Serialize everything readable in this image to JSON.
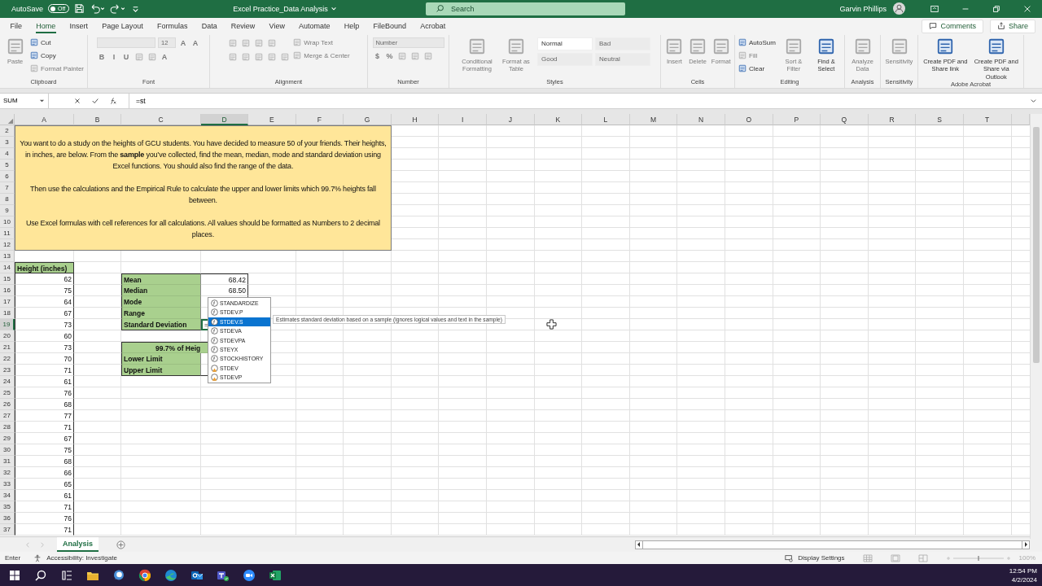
{
  "titlebar": {
    "autosave_label": "AutoSave",
    "autosave_state": "Off",
    "autosave_on": false,
    "title": "Excel Practice_Data Analysis",
    "search_placeholder": "Search",
    "user": "Garvin Phillips"
  },
  "menu_tabs": [
    {
      "label": "File",
      "selected": false
    },
    {
      "label": "Home",
      "selected": true
    },
    {
      "label": "Insert",
      "selected": false
    },
    {
      "label": "Page Layout",
      "selected": false
    },
    {
      "label": "Formulas",
      "selected": false
    },
    {
      "label": "Data",
      "selected": false
    },
    {
      "label": "Review",
      "selected": false
    },
    {
      "label": "View",
      "selected": false
    },
    {
      "label": "Automate",
      "selected": false
    },
    {
      "label": "Help",
      "selected": false
    },
    {
      "label": "FileBound",
      "selected": false
    },
    {
      "label": "Acrobat",
      "selected": false
    }
  ],
  "comments_button": "Comments",
  "share_button": "Share",
  "ribbon": [
    {
      "label": "Clipboard",
      "items": [
        {
          "kind": "large",
          "label": "Paste",
          "disabled": true
        },
        {
          "kind": "stack",
          "items": [
            {
              "kind": "small",
              "label": "Cut",
              "disabled": false
            },
            {
              "kind": "small",
              "label": "Copy",
              "disabled": false
            },
            {
              "kind": "small",
              "label": "Format Painter",
              "disabled": true
            }
          ]
        }
      ]
    },
    {
      "label": "Font",
      "items": [
        {
          "kind": "stack",
          "items": [
            {
              "kind": "row",
              "items": [
                {
                  "kind": "field",
                  "disabled": true
                },
                {
                  "kind": "field",
                  "value": "12",
                  "disabled": true
                },
                {
                  "kind": "glyph",
                  "label": "A",
                  "disabled": true
                },
                {
                  "kind": "glyph",
                  "label": "A",
                  "disabled": true
                }
              ]
            },
            {
              "kind": "row",
              "items": [
                {
                  "kind": "glyph",
                  "label": "B",
                  "disabled": true
                },
                {
                  "kind": "glyph",
                  "label": "I",
                  "disabled": true
                },
                {
                  "kind": "glyph",
                  "label": "U",
                  "disabled": true
                },
                {
                  "kind": "icon",
                  "disabled": true
                },
                {
                  "kind": "icon",
                  "disabled": true
                },
                {
                  "kind": "glyph",
                  "label": "A",
                  "disabled": true
                }
              ]
            }
          ]
        }
      ]
    },
    {
      "label": "Alignment",
      "items": [
        {
          "kind": "stack",
          "items": [
            {
              "kind": "row",
              "items": [
                {
                  "kind": "icon",
                  "disabled": true
                },
                {
                  "kind": "icon",
                  "disabled": true
                },
                {
                  "kind": "icon",
                  "disabled": true
                },
                {
                  "kind": "icon",
                  "disabled": true
                }
              ]
            },
            {
              "kind": "row",
              "items": [
                {
                  "kind": "icon",
                  "disabled": true
                },
                {
                  "kind": "icon",
                  "disabled": true
                },
                {
                  "kind": "icon",
                  "disabled": true
                },
                {
                  "kind": "icon",
                  "disabled": true
                },
                {
                  "kind": "icon",
                  "disabled": true
                }
              ]
            }
          ]
        },
        {
          "kind": "stack",
          "items": [
            {
              "kind": "small",
              "label": "Wrap Text",
              "disabled": true
            },
            {
              "kind": "small",
              "label": "Merge & Center",
              "disabled": true
            }
          ]
        }
      ]
    },
    {
      "label": "Number",
      "items": [
        {
          "kind": "stack",
          "items": [
            {
              "kind": "field",
              "value": "Number",
              "disabled": true
            },
            {
              "kind": "row",
              "items": [
                {
                  "kind": "glyph",
                  "label": "$",
                  "disabled": true
                },
                {
                  "kind": "glyph",
                  "label": "%",
                  "disabled": true
                },
                {
                  "kind": "icon",
                  "disabled": true
                },
                {
                  "kind": "icon",
                  "disabled": true
                },
                {
                  "kind": "icon",
                  "disabled": true
                }
              ]
            }
          ]
        }
      ]
    },
    {
      "label": "Styles",
      "items": [
        {
          "kind": "large",
          "label": "Conditional Formatting",
          "disabled": true
        },
        {
          "kind": "large",
          "label": "Format as Table",
          "disabled": true
        },
        {
          "kind": "stack",
          "items": [
            {
              "kind": "row",
              "items": [
                {
                  "kind": "style",
                  "label": "Normal",
                  "disabled": false
                },
                {
                  "kind": "style",
                  "label": "Bad",
                  "disabled": true
                }
              ]
            },
            {
              "kind": "row",
              "items": [
                {
                  "kind": "style",
                  "label": "Good",
                  "disabled": true
                },
                {
                  "kind": "style",
                  "label": "Neutral",
                  "disabled": true
                }
              ]
            }
          ]
        }
      ]
    },
    {
      "label": "Cells",
      "items": [
        {
          "kind": "large",
          "label": "Insert",
          "disabled": true
        },
        {
          "kind": "large",
          "label": "Delete",
          "disabled": true
        },
        {
          "kind": "large",
          "label": "Format",
          "disabled": true
        }
      ]
    },
    {
      "label": "Editing",
      "items": [
        {
          "kind": "stack",
          "items": [
            {
              "kind": "small",
              "label": "AutoSum",
              "disabled": false
            },
            {
              "kind": "small",
              "label": "Fill",
              "disabled": true
            },
            {
              "kind": "small",
              "label": "Clear",
              "disabled": false
            }
          ]
        },
        {
          "kind": "large",
          "label": "Sort & Filter",
          "disabled": true
        },
        {
          "kind": "large",
          "label": "Find & Select",
          "disabled": false
        }
      ]
    },
    {
      "label": "Analysis",
      "items": [
        {
          "kind": "large",
          "label": "Analyze Data",
          "disabled": true
        }
      ]
    },
    {
      "label": "Sensitivity",
      "items": [
        {
          "kind": "large",
          "label": "Sensitivity",
          "disabled": true
        }
      ]
    },
    {
      "label": "Adobe Acrobat",
      "items": [
        {
          "kind": "large",
          "label": "Create PDF and Share link",
          "disabled": false
        },
        {
          "kind": "large",
          "label": "Create PDF and Share via Outlook",
          "disabled": false
        }
      ]
    }
  ],
  "name_box": "SUM",
  "formula": "=st",
  "columns": [
    {
      "label": "A",
      "selected": false
    },
    {
      "label": "B",
      "selected": false
    },
    {
      "label": "C",
      "selected": false
    },
    {
      "label": "D",
      "selected": true
    },
    {
      "label": "E",
      "selected": false
    },
    {
      "label": "F",
      "selected": false
    },
    {
      "label": "G",
      "selected": false
    },
    {
      "label": "H",
      "selected": false
    },
    {
      "label": "I",
      "selected": false
    },
    {
      "label": "J",
      "selected": false
    },
    {
      "label": "K",
      "selected": false
    },
    {
      "label": "L",
      "selected": false
    },
    {
      "label": "M",
      "selected": false
    },
    {
      "label": "N",
      "selected": false
    },
    {
      "label": "O",
      "selected": false
    },
    {
      "label": "P",
      "selected": false
    },
    {
      "label": "Q",
      "selected": false
    },
    {
      "label": "R",
      "selected": false
    },
    {
      "label": "S",
      "selected": false
    },
    {
      "label": "T",
      "selected": false
    }
  ],
  "rows": [
    {
      "label": "2",
      "selected": false
    },
    {
      "label": "3",
      "selected": false
    },
    {
      "label": "4",
      "selected": false
    },
    {
      "label": "5",
      "selected": false
    },
    {
      "label": "6",
      "selected": false
    },
    {
      "label": "7",
      "selected": false
    },
    {
      "label": "8",
      "selected": false
    },
    {
      "label": "9",
      "selected": false
    },
    {
      "label": "10",
      "selected": false
    },
    {
      "label": "11",
      "selected": false
    },
    {
      "label": "12",
      "selected": false
    },
    {
      "label": "13",
      "selected": false
    },
    {
      "label": "14",
      "selected": false
    },
    {
      "label": "15",
      "selected": false
    },
    {
      "label": "16",
      "selected": false
    },
    {
      "label": "17",
      "selected": false
    },
    {
      "label": "18",
      "selected": false
    },
    {
      "label": "19",
      "selected": true
    },
    {
      "label": "20",
      "selected": false
    },
    {
      "label": "21",
      "selected": false
    },
    {
      "label": "22",
      "selected": false
    },
    {
      "label": "23",
      "selected": false
    },
    {
      "label": "24",
      "selected": false
    },
    {
      "label": "25",
      "selected": false
    },
    {
      "label": "26",
      "selected": false
    },
    {
      "label": "27",
      "selected": false
    },
    {
      "label": "28",
      "selected": false
    },
    {
      "label": "29",
      "selected": false
    },
    {
      "label": "30",
      "selected": false
    },
    {
      "label": "31",
      "selected": false
    },
    {
      "label": "32",
      "selected": false
    },
    {
      "label": "33",
      "selected": false
    },
    {
      "label": "34",
      "selected": false
    },
    {
      "label": "35",
      "selected": false
    },
    {
      "label": "36",
      "selected": false
    },
    {
      "label": "37",
      "selected": false
    }
  ],
  "instructions": [
    "You want to do a study on the heights of GCU students. You have decided to measure 50 of your friends. Their heights, in inches, are below. From the **sample** you’ve collected,  find the mean, median, mode and standard deviation using Excel functions. You should also find the range of the data.",
    "Then use the calculations and the Empirical Rule to calculate the upper and lower limits which 99.7% heights fall between.",
    "Use Excel formulas with cell references for all calculations. All values should be formatted as Numbers to 2 decimal places."
  ],
  "height_header": "Height (inches)",
  "heights": [
    "62",
    "75",
    "64",
    "67",
    "73",
    "60",
    "73",
    "70",
    "71",
    "61",
    "76",
    "68",
    "77",
    "71",
    "67",
    "75",
    "68",
    "66",
    "65",
    "61",
    "71",
    "76",
    "71"
  ],
  "stats": [
    {
      "label": "Mean",
      "value": "68.42"
    },
    {
      "label": "Median",
      "value": "68.50"
    },
    {
      "label": "Mode"
    },
    {
      "label": "Range"
    },
    {
      "label": "Standard Deviation",
      "value": "=",
      "active": true
    }
  ],
  "limits": {
    "header": "99.7% of Heig",
    "rows": [
      "Lower Limit",
      "Upper Limit"
    ]
  },
  "autocomplete": [
    {
      "label": "STANDARDIZE",
      "kind": "function",
      "selected": false
    },
    {
      "label": "STDEV.P",
      "kind": "function",
      "selected": false
    },
    {
      "label": "STDEV.S",
      "kind": "function",
      "selected": true
    },
    {
      "label": "STDEVA",
      "kind": "function",
      "selected": false
    },
    {
      "label": "STDEVPA",
      "kind": "function",
      "selected": false
    },
    {
      "label": "STEYX",
      "kind": "function",
      "selected": false
    },
    {
      "label": "STOCKHISTORY",
      "kind": "function",
      "selected": false
    },
    {
      "label": "STDEV",
      "kind": "compat",
      "selected": false
    },
    {
      "label": "STDEVP",
      "kind": "compat",
      "selected": false
    }
  ],
  "tooltip": "Estimates standard deviation based on a sample (ignores logical values and text in the sample)",
  "sheet_tabs": [
    {
      "label": "Analysis",
      "selected": true
    }
  ],
  "status": {
    "mode": "Enter",
    "accessibility": "Accessibility: Investigate",
    "display_settings": "Display Settings",
    "zoom": "100%",
    "zoom_slider": {
      "level": 0.5
    }
  },
  "taskbar": {
    "time": "12:54 PM",
    "date": "4/2/2024"
  }
}
